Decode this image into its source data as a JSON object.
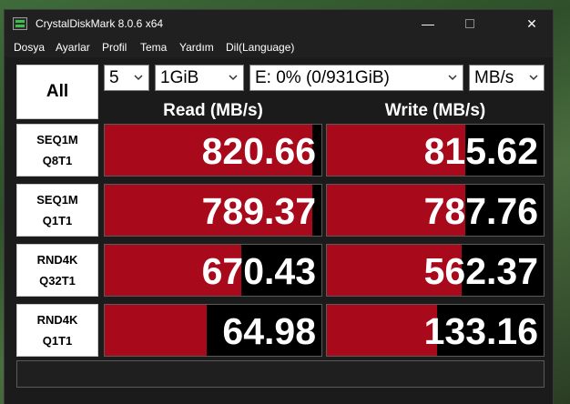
{
  "window": {
    "title": "CrystalDiskMark 8.0.6 x64",
    "icons": [
      "app-icon",
      "minimize-icon",
      "maximize-icon",
      "close-icon"
    ]
  },
  "menu": [
    "Dosya",
    "Ayarlar",
    "Profil",
    "Tema",
    "Yardım",
    "Dil(Language)"
  ],
  "controls": {
    "all_label": "All",
    "count": "5",
    "size": "1GiB",
    "drive": "E: 0% (0/931GiB)",
    "unit": "MB/s"
  },
  "columns": {
    "read": "Read (MB/s)",
    "write": "Write (MB/s)"
  },
  "tests": [
    {
      "line1": "SEQ1M",
      "line2": "Q8T1",
      "read": "820.66",
      "write": "815.62",
      "read_fill": 0.96,
      "write_fill": 0.64
    },
    {
      "line1": "SEQ1M",
      "line2": "Q1T1",
      "read": "789.37",
      "write": "787.76",
      "read_fill": 0.96,
      "write_fill": 0.64
    },
    {
      "line1": "RND4K",
      "line2": "Q32T1",
      "read": "670.43",
      "write": "562.37",
      "read_fill": 0.63,
      "write_fill": 0.62
    },
    {
      "line1": "RND4K",
      "line2": "Q1T1",
      "read": "64.98",
      "write": "133.16",
      "read_fill": 0.47,
      "write_fill": 0.51
    }
  ],
  "comment": "",
  "colors": {
    "bar": "#a80a1b",
    "background": "#1b1b1b"
  }
}
